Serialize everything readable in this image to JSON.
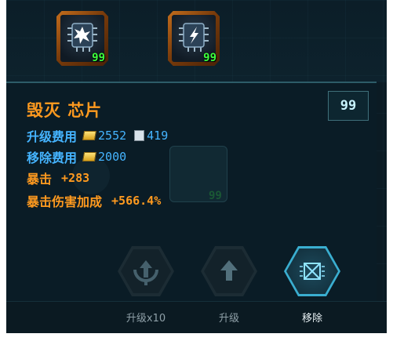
{
  "chips": [
    {
      "count": "99",
      "icon": "chip-burst-icon"
    },
    {
      "count": "99",
      "icon": "chip-lightning-icon"
    }
  ],
  "panel": {
    "level": "99",
    "title": "毁灭 芯片",
    "upgrade_cost_label": "升级费用",
    "upgrade_cost_gold": "2552",
    "upgrade_cost_chips": "419",
    "remove_cost_label": "移除费用",
    "remove_cost_gold": "2000",
    "stat1_label": "暴击",
    "stat1_value": "+283",
    "stat2_label": "暴击伤害加成",
    "stat2_value": "+566.4%"
  },
  "background_chip_count": "99",
  "actions": [
    {
      "label": "升级x10",
      "icon": "upgrade-x10-icon",
      "state": "disabled"
    },
    {
      "label": "升级",
      "icon": "upgrade-arrow-icon",
      "state": "disabled"
    },
    {
      "label": "移除",
      "icon": "remove-chip-icon",
      "state": "active"
    }
  ],
  "colors": {
    "accent_orange": "#ff9a1f",
    "accent_blue": "#45b4ff",
    "count_green": "#3dff3d",
    "active_cyan": "#3aaed0"
  }
}
